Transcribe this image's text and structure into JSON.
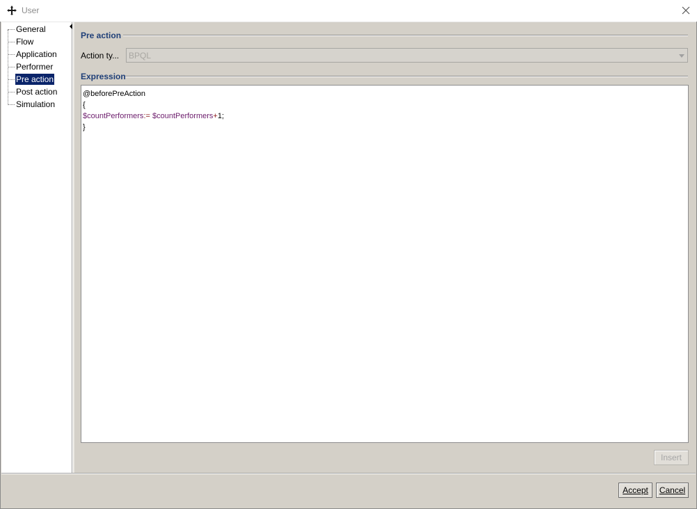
{
  "window": {
    "title": "User",
    "icon": "plus-cross-icon"
  },
  "tree": {
    "items": [
      {
        "label": "General"
      },
      {
        "label": "Flow"
      },
      {
        "label": "Application"
      },
      {
        "label": "Performer"
      },
      {
        "label": "Pre action",
        "selected": true
      },
      {
        "label": "Post action"
      },
      {
        "label": "Simulation"
      }
    ]
  },
  "pre_action": {
    "section_title": "Pre action",
    "action_type_label": "Action ty...",
    "action_type_value": "BPQL"
  },
  "expression": {
    "section_title": "Expression",
    "lines": {
      "l1": "@beforePreAction",
      "l2": "{",
      "l3_var1": "$countPerformers",
      "l3_op1": ":=",
      "l3_var2": "$countPerformers",
      "l3_op2": "+",
      "l3_num": "1;",
      "l4": "}"
    }
  },
  "buttons": {
    "insert": "Insert",
    "accept": "Accept",
    "cancel": "Cancel"
  }
}
